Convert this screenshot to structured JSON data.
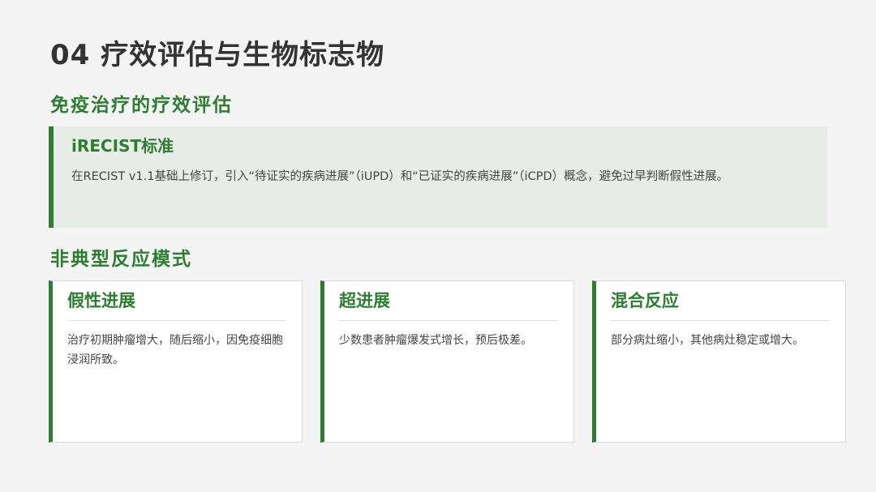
{
  "page_title": "04 疗效评估与生物标志物",
  "section1": {
    "title": "免疫治疗的疗效评估",
    "callout": {
      "title": "iRECIST标准",
      "text": "在RECIST v1.1基础上修订，引入“待证实的疾病进展”（iUPD）和“已证实的疾病进展”（iCPD）概念，避免过早判断假性进展。"
    }
  },
  "section2": {
    "title": "非典型反应模式",
    "cards": [
      {
        "title": "假性进展",
        "text": "治疗初期肿瘤增大，随后缩小，因免疫细胞浸润所致。"
      },
      {
        "title": "超进展",
        "text": "少数患者肿瘤爆发式增长，预后极差。"
      },
      {
        "title": "混合反应",
        "text": "部分病灶缩小，其他病灶稳定或增大。"
      }
    ]
  },
  "colors": {
    "accent": "#2e7d32",
    "callout_bg": "#e8ece7",
    "background": "#f4f4f4"
  }
}
